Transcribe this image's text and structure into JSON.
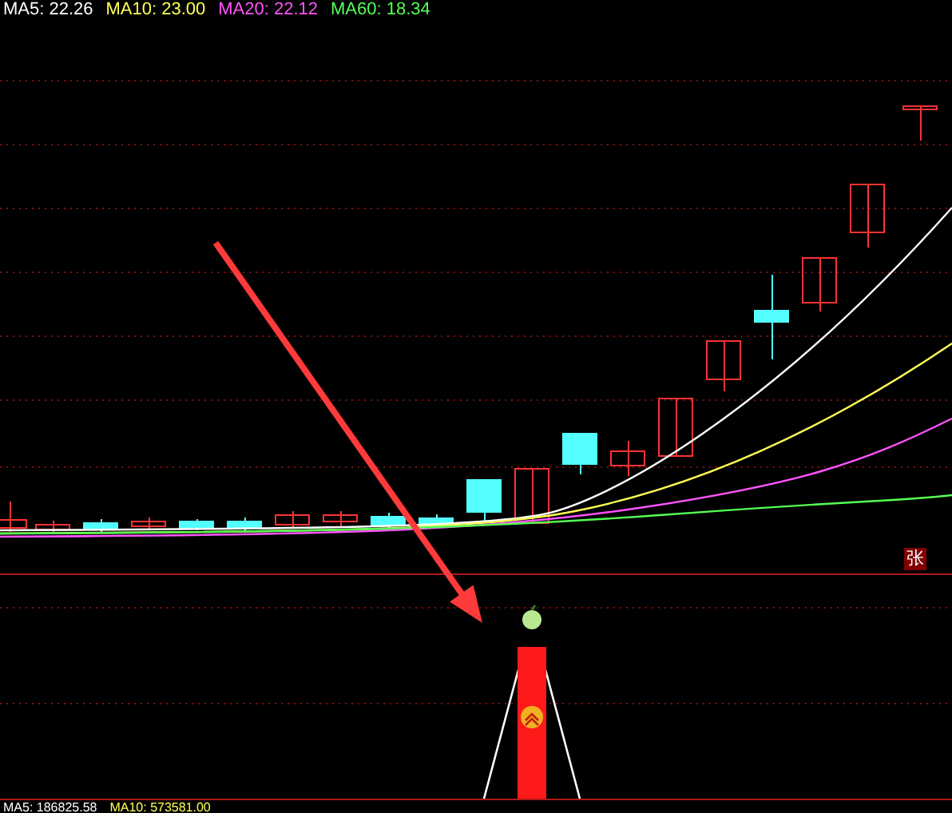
{
  "price_legend": [
    {
      "label": "MA5: 22.26",
      "color": "#ffffff"
    },
    {
      "label": "MA10: 23.00",
      "color": "#ffff54"
    },
    {
      "label": "MA20: 22.12",
      "color": "#ff54ff"
    },
    {
      "label": "MA60: 18.34",
      "color": "#54ff54"
    }
  ],
  "volume_legend": [
    {
      "label": "MA5: 186825.58",
      "color": "#ffffff"
    },
    {
      "label": "MA10: 573581.00",
      "color": "#ffff54"
    }
  ],
  "badge": "张"
}
